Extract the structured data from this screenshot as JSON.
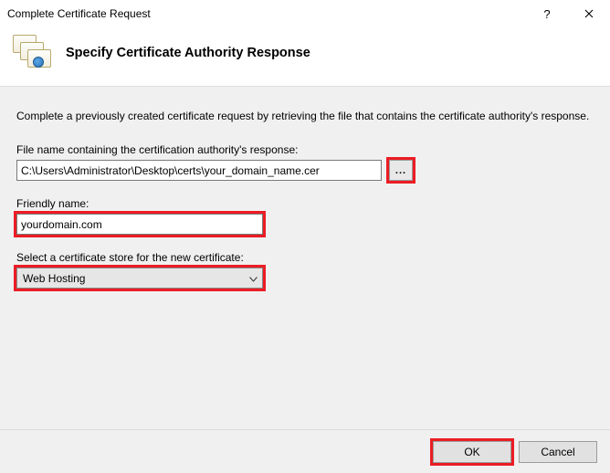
{
  "window": {
    "title": "Complete Certificate Request",
    "help": "?",
    "close": "×"
  },
  "header": {
    "heading": "Specify Certificate Authority Response"
  },
  "form": {
    "intro": "Complete a previously created certificate request by retrieving the file that contains the certificate authority's response.",
    "file_label": "File name containing the certification authority's response:",
    "file_value": "C:\\Users\\Administrator\\Desktop\\certs\\your_domain_name.cer",
    "browse_label": "...",
    "friendly_label": "Friendly name:",
    "friendly_value": "yourdomain.com",
    "store_label": "Select a certificate store for the new certificate:",
    "store_value": "Web Hosting"
  },
  "footer": {
    "ok": "OK",
    "cancel": "Cancel"
  }
}
